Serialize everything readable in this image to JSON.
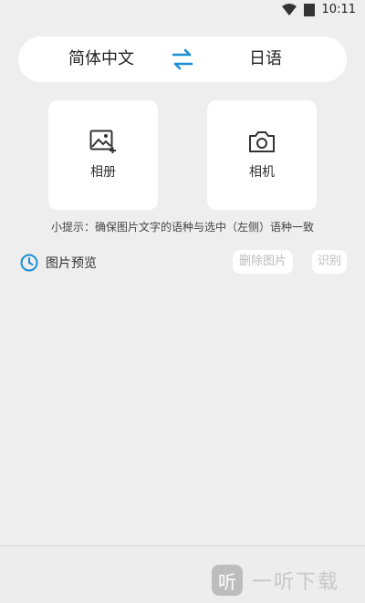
{
  "status_bar": {
    "time": "10:11"
  },
  "language_bar": {
    "source": "简体中文",
    "target": "日语"
  },
  "actions": {
    "album_label": "相册",
    "camera_label": "相机"
  },
  "tip": "小提示：确保图片文字的语种与选中（左侧）语种一致",
  "preview": {
    "label": "图片预览",
    "delete_label": "删除图片",
    "recognize_label": "识别"
  },
  "watermark": {
    "logo": "听",
    "text": "一听下载"
  },
  "colors": {
    "accent": "#1a8fd6",
    "disabled_text": "#bbbbbb",
    "background": "#eeeeee"
  }
}
